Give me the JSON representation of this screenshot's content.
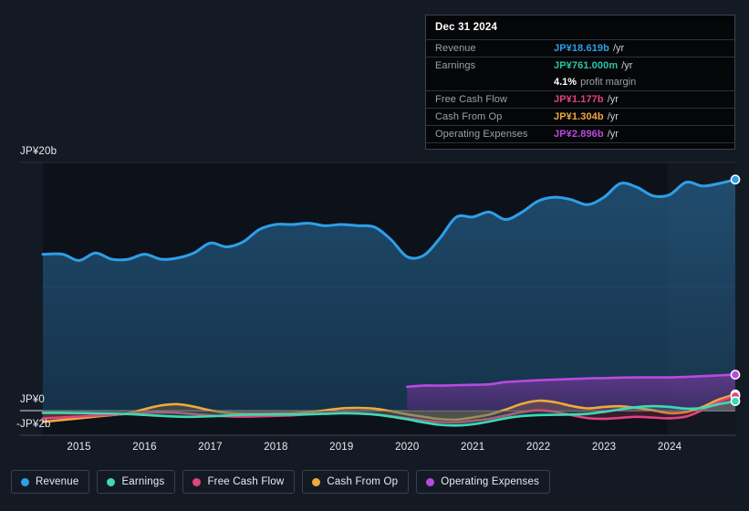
{
  "tooltip": {
    "title": "Dec 31 2024",
    "rows": [
      {
        "key": "Revenue",
        "value": "JP¥18.619b",
        "unit": "/yr",
        "color": "#2e9fe8"
      },
      {
        "key": "Earnings",
        "value": "JP¥761.000m",
        "unit": "/yr",
        "color": "#28c5a5"
      },
      {
        "key": "Free Cash Flow",
        "value": "JP¥1.177b",
        "unit": "/yr",
        "color": "#e0447c"
      },
      {
        "key": "Cash From Op",
        "value": "JP¥1.304b",
        "unit": "/yr",
        "color": "#efa93c"
      },
      {
        "key": "Operating Expenses",
        "value": "JP¥2.896b",
        "unit": "/yr",
        "color": "#b94ae0"
      }
    ],
    "profit_margin_value": "4.1%",
    "profit_margin_label": "profit margin"
  },
  "legend": {
    "items": [
      {
        "label": "Revenue",
        "color": "#2e9fe8"
      },
      {
        "label": "Earnings",
        "color": "#3fd8b4"
      },
      {
        "label": "Free Cash Flow",
        "color": "#e0447c"
      },
      {
        "label": "Cash From Op",
        "color": "#efa93c"
      },
      {
        "label": "Operating Expenses",
        "color": "#b94ae0"
      }
    ]
  },
  "chart_data": {
    "type": "area",
    "title": "",
    "xlabel": "",
    "ylabel": "",
    "grid": true,
    "legend_position": "bottom",
    "y_axis": {
      "labels": [
        "JP¥20b",
        "JP¥0",
        "-JP¥2b"
      ],
      "ticks": [
        20,
        0,
        -2
      ],
      "ylim": [
        -2,
        20
      ],
      "gridlines": [
        20,
        10,
        0
      ],
      "unit": "JP¥ billions"
    },
    "x_axis": {
      "tick_labels": [
        "2015",
        "2016",
        "2017",
        "2018",
        "2019",
        "2020",
        "2021",
        "2022",
        "2023",
        "2024"
      ],
      "xlim": [
        2014.45,
        2025.0
      ]
    },
    "series": [
      {
        "name": "Revenue",
        "color": "#2e9fe8",
        "fill": "rgba(46,120,180,0.40)",
        "end_marker": true,
        "x": [
          2014.45,
          2014.75,
          2015.0,
          2015.25,
          2015.5,
          2015.75,
          2016.0,
          2016.25,
          2016.5,
          2016.75,
          2017.0,
          2017.25,
          2017.5,
          2017.75,
          2018.0,
          2018.25,
          2018.5,
          2018.75,
          2019.0,
          2019.25,
          2019.5,
          2019.75,
          2020.0,
          2020.25,
          2020.5,
          2020.75,
          2021.0,
          2021.25,
          2021.5,
          2021.75,
          2022.0,
          2022.25,
          2022.5,
          2022.75,
          2023.0,
          2023.25,
          2023.5,
          2023.75,
          2024.0,
          2024.25,
          2024.5,
          2024.75,
          2025.0
        ],
        "y": [
          12.6,
          12.6,
          12.1,
          12.7,
          12.2,
          12.2,
          12.6,
          12.2,
          12.3,
          12.7,
          13.5,
          13.2,
          13.6,
          14.6,
          15.0,
          15.0,
          15.1,
          14.9,
          15.0,
          14.9,
          14.8,
          13.8,
          12.4,
          12.5,
          13.9,
          15.6,
          15.6,
          16.0,
          15.4,
          16.0,
          16.9,
          17.2,
          17.0,
          16.6,
          17.2,
          18.3,
          18.0,
          17.3,
          17.4,
          18.4,
          18.1,
          18.3,
          18.619
        ]
      },
      {
        "name": "Operating Expenses",
        "color": "#b94ae0",
        "fill": "rgba(120,55,160,0.48)",
        "end_marker": true,
        "x": [
          2020.0,
          2020.25,
          2020.5,
          2020.75,
          2021.0,
          2021.25,
          2021.5,
          2021.75,
          2022.0,
          2022.25,
          2022.5,
          2022.75,
          2023.0,
          2023.25,
          2023.5,
          2023.75,
          2024.0,
          2024.25,
          2024.5,
          2024.75,
          2025.0
        ],
        "y": [
          1.92,
          2.02,
          2.02,
          2.05,
          2.08,
          2.12,
          2.3,
          2.38,
          2.45,
          2.5,
          2.55,
          2.6,
          2.62,
          2.66,
          2.68,
          2.68,
          2.68,
          2.72,
          2.78,
          2.84,
          2.896
        ]
      },
      {
        "name": "Cash From Op",
        "color": "#efa93c",
        "fill": "rgba(150,110,60,0.35)",
        "end_marker": true,
        "x": [
          2014.45,
          2014.75,
          2015.0,
          2015.25,
          2015.5,
          2015.75,
          2016.0,
          2016.25,
          2016.5,
          2016.75,
          2017.0,
          2017.25,
          2017.5,
          2017.75,
          2018.0,
          2018.25,
          2018.5,
          2018.75,
          2019.0,
          2019.25,
          2019.5,
          2019.75,
          2020.0,
          2020.25,
          2020.5,
          2020.75,
          2021.0,
          2021.25,
          2021.5,
          2021.75,
          2022.0,
          2022.25,
          2022.5,
          2022.75,
          2023.0,
          2023.25,
          2023.5,
          2023.75,
          2024.0,
          2024.25,
          2024.5,
          2024.75,
          2025.0
        ],
        "y": [
          -0.9,
          -0.75,
          -0.62,
          -0.48,
          -0.36,
          -0.22,
          0.12,
          0.42,
          0.52,
          0.32,
          0.02,
          -0.18,
          -0.25,
          -0.26,
          -0.24,
          -0.22,
          -0.12,
          0.02,
          0.18,
          0.22,
          0.16,
          -0.05,
          -0.3,
          -0.5,
          -0.68,
          -0.72,
          -0.55,
          -0.32,
          0.08,
          0.55,
          0.8,
          0.68,
          0.38,
          0.18,
          0.3,
          0.35,
          0.22,
          0.02,
          -0.2,
          -0.12,
          0.3,
          0.9,
          1.304
        ]
      },
      {
        "name": "Free Cash Flow",
        "color": "#e0447c",
        "fill": "rgba(160,50,90,0.32)",
        "end_marker": true,
        "x": [
          2014.45,
          2014.75,
          2015.0,
          2015.25,
          2015.5,
          2015.75,
          2016.0,
          2016.25,
          2016.5,
          2016.75,
          2017.0,
          2017.25,
          2017.5,
          2017.75,
          2018.0,
          2018.25,
          2018.5,
          2018.75,
          2019.0,
          2019.25,
          2019.5,
          2019.75,
          2020.0,
          2020.25,
          2020.5,
          2020.75,
          2021.0,
          2021.25,
          2021.5,
          2021.75,
          2022.0,
          2022.25,
          2022.5,
          2022.75,
          2023.0,
          2023.25,
          2023.5,
          2023.75,
          2024.0,
          2024.25,
          2024.5,
          2024.75,
          2025.0
        ],
        "y": [
          -0.62,
          -0.55,
          -0.48,
          -0.4,
          -0.34,
          -0.26,
          -0.18,
          -0.14,
          -0.18,
          -0.28,
          -0.38,
          -0.46,
          -0.48,
          -0.46,
          -0.42,
          -0.38,
          -0.3,
          -0.22,
          -0.18,
          -0.2,
          -0.3,
          -0.45,
          -0.62,
          -0.78,
          -0.92,
          -0.95,
          -0.82,
          -0.66,
          -0.4,
          -0.12,
          0.02,
          -0.1,
          -0.36,
          -0.6,
          -0.66,
          -0.58,
          -0.5,
          -0.56,
          -0.62,
          -0.48,
          0.05,
          0.72,
          1.177
        ]
      },
      {
        "name": "Earnings",
        "color": "#3fd8b4",
        "fill": "rgba(40,160,140,0.30)",
        "end_marker": true,
        "x": [
          2014.45,
          2014.75,
          2015.0,
          2015.25,
          2015.5,
          2015.75,
          2016.0,
          2016.25,
          2016.5,
          2016.75,
          2017.0,
          2017.25,
          2017.5,
          2017.75,
          2018.0,
          2018.25,
          2018.5,
          2018.75,
          2019.0,
          2019.25,
          2019.5,
          2019.75,
          2020.0,
          2020.25,
          2020.5,
          2020.75,
          2021.0,
          2021.25,
          2021.5,
          2021.75,
          2022.0,
          2022.25,
          2022.5,
          2022.75,
          2023.0,
          2023.25,
          2023.5,
          2023.75,
          2024.0,
          2024.25,
          2024.5,
          2024.75,
          2025.0
        ],
        "y": [
          -0.18,
          -0.18,
          -0.2,
          -0.22,
          -0.24,
          -0.28,
          -0.35,
          -0.42,
          -0.48,
          -0.5,
          -0.46,
          -0.4,
          -0.34,
          -0.32,
          -0.32,
          -0.32,
          -0.3,
          -0.26,
          -0.22,
          -0.24,
          -0.32,
          -0.48,
          -0.7,
          -0.95,
          -1.15,
          -1.2,
          -1.1,
          -0.88,
          -0.62,
          -0.44,
          -0.36,
          -0.34,
          -0.32,
          -0.26,
          -0.1,
          0.1,
          0.28,
          0.36,
          0.3,
          0.16,
          0.22,
          0.52,
          0.761
        ]
      }
    ],
    "highlight_band": {
      "from": 2023.96,
      "to": 2025.0
    }
  }
}
